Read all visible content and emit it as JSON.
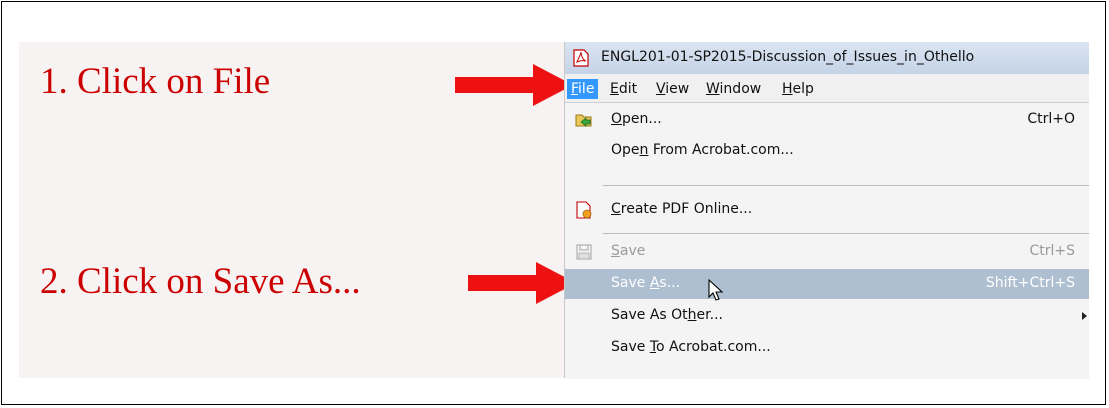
{
  "instructions": {
    "step1": "1. Click on File",
    "step2": "2. Click on Save As..."
  },
  "window": {
    "title": "ENGL201-01-SP2015-Discussion_of_Issues_in_Othello"
  },
  "menubar": {
    "items": [
      {
        "label": "File",
        "mnemonic": "F",
        "rest": "ile"
      },
      {
        "label": "Edit",
        "mnemonic": "E",
        "rest": "dit"
      },
      {
        "label": "View",
        "mnemonic": "V",
        "rest": "iew"
      },
      {
        "label": "Window",
        "mnemonic": "W",
        "rest": "indow"
      },
      {
        "label": "Help",
        "mnemonic": "H",
        "rest": "elp"
      }
    ]
  },
  "file_menu": {
    "open": {
      "pre": "",
      "mn": "O",
      "post": "pen...",
      "shortcut": "Ctrl+O"
    },
    "open_acrobat": {
      "pre": "Ope",
      "mn": "n",
      "post": " From Acrobat.com..."
    },
    "create_pdf": {
      "pre": "",
      "mn": "C",
      "post": "reate PDF Online..."
    },
    "save": {
      "pre": "",
      "mn": "S",
      "post": "ave",
      "shortcut": "Ctrl+S"
    },
    "save_as": {
      "pre": "Save ",
      "mn": "A",
      "post": "s...",
      "shortcut": "Shift+Ctrl+S"
    },
    "save_as_other": {
      "pre": "Save As Ot",
      "mn": "h",
      "post": "er..."
    },
    "save_to_acrobat": {
      "pre": "Save ",
      "mn": "T",
      "post": "o Acrobat.com..."
    }
  },
  "colors": {
    "instruction_red": "#cc0000",
    "menu_active": "#3399ff",
    "row_highlight": "#aebfd1"
  }
}
